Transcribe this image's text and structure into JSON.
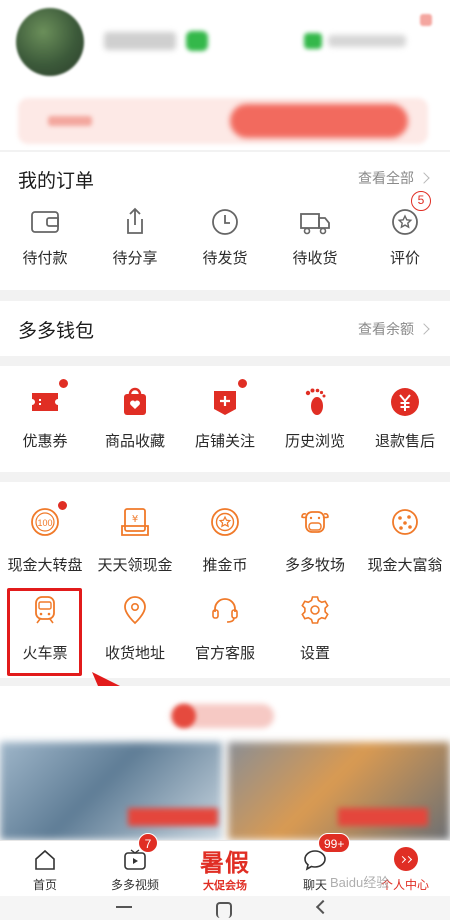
{
  "orders": {
    "title": "我的订单",
    "more": "查看全部",
    "items": [
      {
        "label": "待付款",
        "icon": "wallet-icon"
      },
      {
        "label": "待分享",
        "icon": "share-icon"
      },
      {
        "label": "待发货",
        "icon": "clock-icon"
      },
      {
        "label": "待收货",
        "icon": "truck-icon"
      },
      {
        "label": "评价",
        "icon": "review-icon"
      }
    ],
    "review_badge": "5"
  },
  "wallet": {
    "title": "多多钱包",
    "more": "查看余额"
  },
  "favorites": {
    "items": [
      {
        "label": "优惠券",
        "icon": "coupon-icon"
      },
      {
        "label": "商品收藏",
        "icon": "favorite-bag-icon"
      },
      {
        "label": "店铺关注",
        "icon": "store-follow-icon"
      },
      {
        "label": "历史浏览",
        "icon": "footprint-icon"
      },
      {
        "label": "退款售后",
        "icon": "refund-icon"
      }
    ]
  },
  "tools": {
    "items": [
      {
        "label": "现金大转盘",
        "icon": "wheel-icon"
      },
      {
        "label": "天天领现金",
        "icon": "cash-envelope-icon"
      },
      {
        "label": "推金币",
        "icon": "coin-icon"
      },
      {
        "label": "多多牧场",
        "icon": "cow-icon"
      },
      {
        "label": "现金大富翁",
        "icon": "dice-icon"
      },
      {
        "label": "火车票",
        "icon": "train-icon"
      },
      {
        "label": "收货地址",
        "icon": "location-icon"
      },
      {
        "label": "官方客服",
        "icon": "headset-icon"
      },
      {
        "label": "设置",
        "icon": "gear-icon"
      }
    ]
  },
  "bottom_nav": {
    "items": [
      {
        "label": "首页",
        "icon": "home-icon"
      },
      {
        "label": "多多视频",
        "icon": "video-icon",
        "badge": "7"
      },
      {
        "label": "大促会场",
        "promo_word": "暑假"
      },
      {
        "label": "聊天",
        "icon": "chat-icon",
        "badge": "99+"
      },
      {
        "label": "个人中心",
        "icon": "profile-icon"
      }
    ]
  },
  "watermark": "Baidu经验",
  "colors": {
    "accent": "#e02e24",
    "icon_orange": "#f07a2a",
    "highlight": "#e21b1b",
    "text": "#2a2a2a",
    "muted": "#8a8a8a"
  }
}
